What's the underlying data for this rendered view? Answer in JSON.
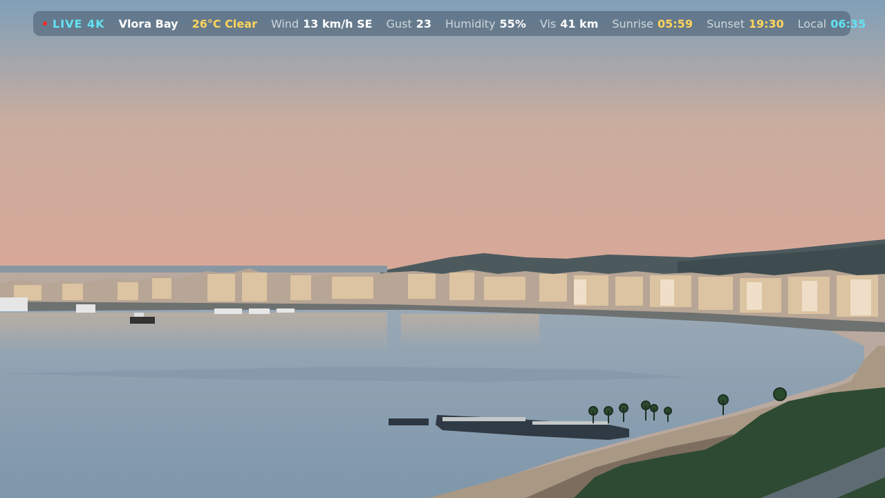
{
  "overlay": {
    "live": "LIVE 4K",
    "location": "Vlora Bay",
    "weather": "26°C Clear",
    "wind_label": "Wind",
    "wind_value": "13 km/h SE",
    "gust_label": "Gust",
    "gust_value": "23",
    "humidity_label": "Humidity",
    "humidity_value": "55%",
    "vis_label": "Vis",
    "vis_value": "41 km",
    "sunrise_label": "Sunrise",
    "sunrise_value": "05:59",
    "sunset_label": "Sunset",
    "sunset_value": "19:30",
    "local_label": "Local",
    "local_value": "06:35"
  },
  "colors": {
    "sky_top": "#7f9fb8",
    "sky_bottom": "#d4a79b",
    "water": "#8fa2b3",
    "accent_cyan": "#62e3f3",
    "accent_yellow": "#ffd45a",
    "live_dot": "#ff2a2a"
  }
}
